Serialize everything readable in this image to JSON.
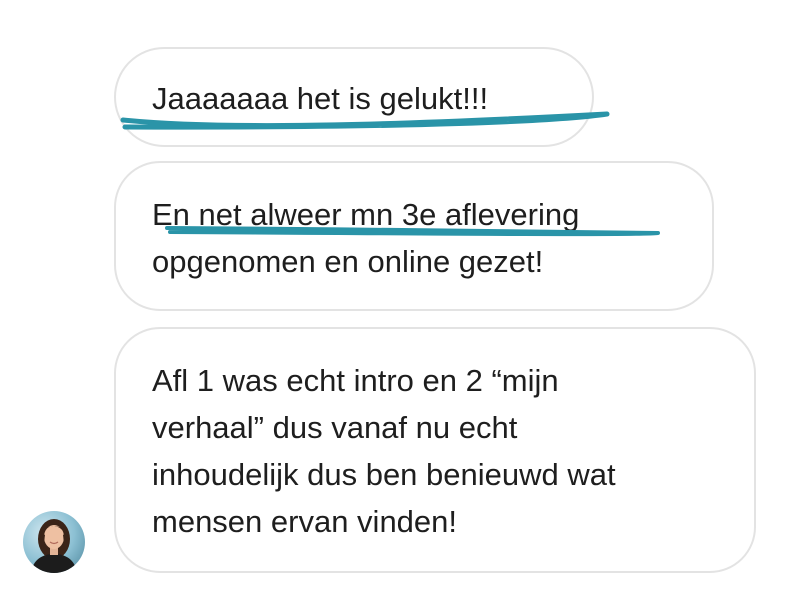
{
  "conversation": {
    "messages": [
      {
        "text": "Jaaaaaaa het is gelukt!!!"
      },
      {
        "text": "En net alweer mn 3e aflevering\nopgenomen en online gezet!"
      },
      {
        "text": "Afl 1 was echt intro en 2 “mijn\nverhaal” dus vanaf nu echt\ninhoudelijk dus ben benieuwd wat\nmensen ervan vinden!"
      }
    ]
  },
  "sender": {
    "avatar_icon": "profile-photo"
  },
  "colors": {
    "highlight": "#2a94a8",
    "bubble_border": "#e3e3e3",
    "text": "#1e1e1e",
    "background": "#ffffff"
  }
}
